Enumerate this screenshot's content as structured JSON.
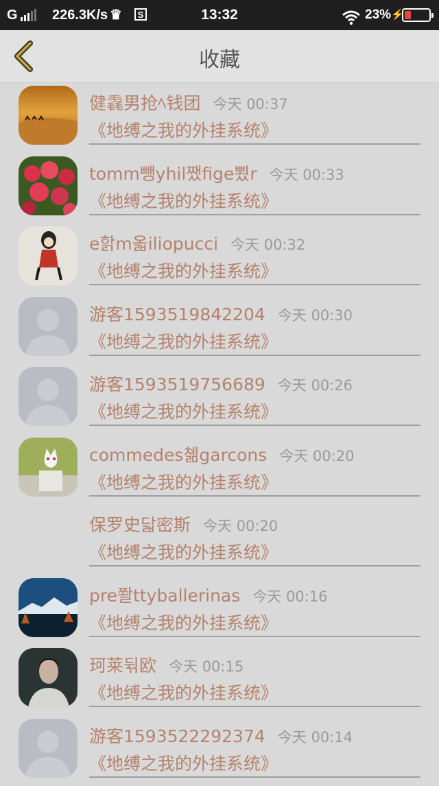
{
  "status_bar": {
    "carrier": "G",
    "speed": "226.3K/s",
    "sim_label": "S",
    "time": "13:32",
    "battery_percent": "23%"
  },
  "header": {
    "title": "收藏"
  },
  "items": [
    {
      "name": "健毳男抢ﾍ钱团",
      "time": "今天 00:37",
      "subtitle": "《地缚之我的外挂系统》",
      "avatar": "desert-photo"
    },
    {
      "name": "tomm뺑yhil쨌fige뾨r",
      "time": "今天 00:33",
      "subtitle": "《地缚之我的外挂系统》",
      "avatar": "flowers-photo"
    },
    {
      "name": "e핡m옯iliopucci",
      "time": "今天 00:32",
      "subtitle": "《地缚之我的外挂系统》",
      "avatar": "girl-drawing"
    },
    {
      "name": "游客1593519842204",
      "time": "今天 00:30",
      "subtitle": "《地缚之我的外挂系统》",
      "avatar": "default-person"
    },
    {
      "name": "游客1593519756689",
      "time": "今天 00:26",
      "subtitle": "《地缚之我的外挂系统》",
      "avatar": "default-person"
    },
    {
      "name": "commedes쳶garcons",
      "time": "今天 00:20",
      "subtitle": "《地缚之我的外挂系统》",
      "avatar": "cat-cartoon"
    },
    {
      "name": "保罗史닯密斯",
      "time": "今天 00:20",
      "subtitle": "《地缚之我的外挂系统》",
      "avatar": "none"
    },
    {
      "name": "pre쫠ttyballerinas",
      "time": "今天 00:16",
      "subtitle": "《地缚之我的外挂系统》",
      "avatar": "mountain-lake-photo"
    },
    {
      "name": "珂莱뒦欧",
      "time": "今天 00:15",
      "subtitle": "《地缚之我的外挂系统》",
      "avatar": "man-portrait"
    },
    {
      "name": "游客1593522292374",
      "time": "今天 00:14",
      "subtitle": "《地缚之我的外挂系统》",
      "avatar": "default-person"
    }
  ]
}
